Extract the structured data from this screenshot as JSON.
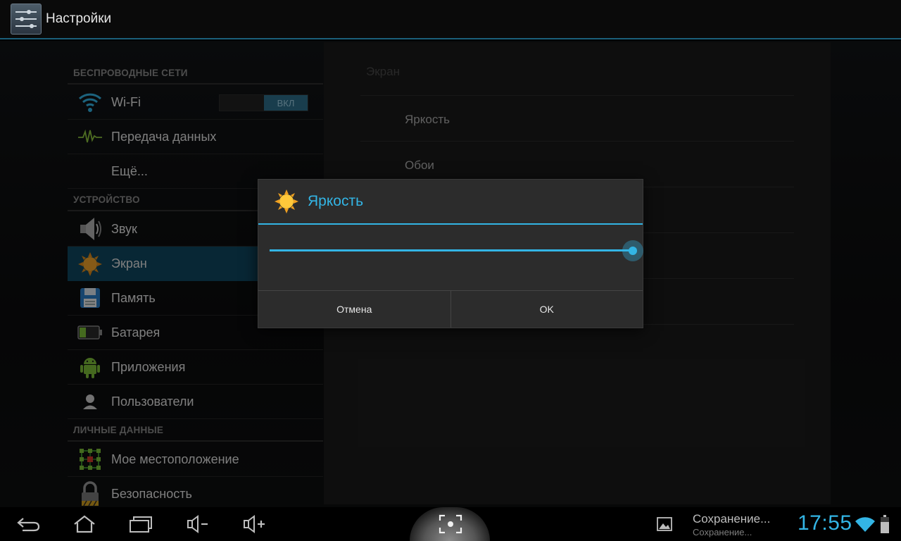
{
  "actionbar": {
    "title": "Настройки",
    "icon": "settings-sliders-icon"
  },
  "sections": {
    "wireless": "БЕСПРОВОДНЫЕ СЕТИ",
    "device": "УСТРОЙСТВО",
    "personal": "ЛИЧНЫЕ ДАННЫЕ"
  },
  "settings_items": {
    "wifi": {
      "label": "Wi-Fi",
      "toggle": "ВКЛ",
      "icon": "wifi-icon"
    },
    "data": {
      "label": "Передача данных",
      "icon": "data-usage-icon"
    },
    "more": {
      "label": "Ещё..."
    },
    "sound": {
      "label": "Звук",
      "icon": "speaker-icon"
    },
    "display": {
      "label": "Экран",
      "icon": "sun-icon",
      "selected": true
    },
    "storage": {
      "label": "Память",
      "icon": "floppy-disk-icon"
    },
    "battery": {
      "label": "Батарея",
      "icon": "battery-icon"
    },
    "apps": {
      "label": "Приложения",
      "icon": "android-icon"
    },
    "users": {
      "label": "Пользователи",
      "icon": "user-icon"
    },
    "location": {
      "label": "Мое местоположение",
      "icon": "location-grid-icon"
    },
    "security": {
      "label": "Безопасность",
      "icon": "padlock-icon"
    }
  },
  "detail": {
    "title": "Экран",
    "items": [
      "Яркость",
      "Обои"
    ]
  },
  "dialog": {
    "title": "Яркость",
    "icon": "sun-icon",
    "brightness": 1.0,
    "cancel": "Отмена",
    "ok": "OK"
  },
  "navbar": {
    "notification_title": "Сохранение...",
    "notification_sub": "Сохранение...",
    "clock": "17:55"
  },
  "colors": {
    "accent": "#33b5e5",
    "selected_bg": "#0f4862"
  }
}
